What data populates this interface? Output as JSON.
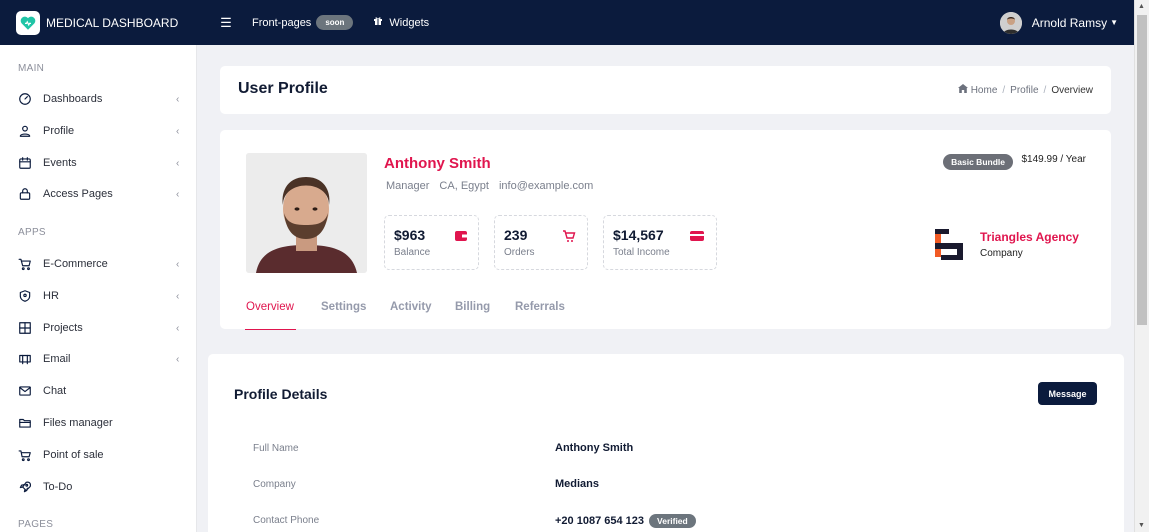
{
  "topbar": {
    "brand": "MEDICAL DASHBOARD",
    "menu_icon": "hamburger-icon",
    "frontpages_label": "Front-pages",
    "soon_badge": "soon",
    "widgets_label": "Widgets",
    "user_name": "Arnold Ramsy",
    "colors": {
      "bg": "#0b1b3d",
      "accent": "#e0154e",
      "brand_icon": "#20c4a6"
    }
  },
  "sidebar": {
    "sections": [
      "MAIN",
      "APPS",
      "PAGES"
    ],
    "items": [
      {
        "label": "Dashboards",
        "icon": "gauge-icon",
        "has_submenu": true
      },
      {
        "label": "Profile",
        "icon": "user-icon",
        "has_submenu": true
      },
      {
        "label": "Events",
        "icon": "calendar-icon",
        "has_submenu": true
      },
      {
        "label": "Access Pages",
        "icon": "lock-icon",
        "has_submenu": true
      },
      {
        "label": "E-Commerce",
        "icon": "cart-icon",
        "has_submenu": true
      },
      {
        "label": "HR",
        "icon": "shield-icon",
        "has_submenu": true
      },
      {
        "label": "Projects",
        "icon": "grid-icon",
        "has_submenu": true
      },
      {
        "label": "Email",
        "icon": "mail-open-icon",
        "has_submenu": true
      },
      {
        "label": "Chat",
        "icon": "envelope-icon",
        "has_submenu": false
      },
      {
        "label": "Files manager",
        "icon": "folder-icon",
        "has_submenu": false
      },
      {
        "label": "Point of sale",
        "icon": "basket-icon",
        "has_submenu": false
      },
      {
        "label": "To-Do",
        "icon": "rocket-icon",
        "has_submenu": false
      }
    ]
  },
  "page_header": {
    "title": "User Profile",
    "breadcrumb": [
      "Home",
      "Profile",
      "Overview"
    ]
  },
  "profile": {
    "name": "Anthony Smith",
    "role": "Manager",
    "location": "CA, Egypt",
    "email": "info@example.com",
    "bundle": "Basic Bundle",
    "price": "$149.99 / Year",
    "stats": [
      {
        "value": "$963",
        "label": "Balance",
        "icon": "wallet-icon"
      },
      {
        "value": "239",
        "label": "Orders",
        "icon": "cart-icon"
      },
      {
        "value": "$14,567",
        "label": "Total Income",
        "icon": "credit-card-icon"
      }
    ],
    "company_name": "Triangles Agency",
    "company_label": "Company",
    "tabs": [
      "Overview",
      "Settings",
      "Activity",
      "Billing",
      "Referrals"
    ],
    "active_tab": "Overview"
  },
  "details": {
    "title": "Profile Details",
    "message_button": "Message",
    "rows": [
      {
        "label": "Full Name",
        "value": "Anthony Smith"
      },
      {
        "label": "Company",
        "value": "Medians"
      },
      {
        "label": "Contact Phone",
        "value": "+20 1087 654 123",
        "badge": "Verified"
      }
    ]
  }
}
